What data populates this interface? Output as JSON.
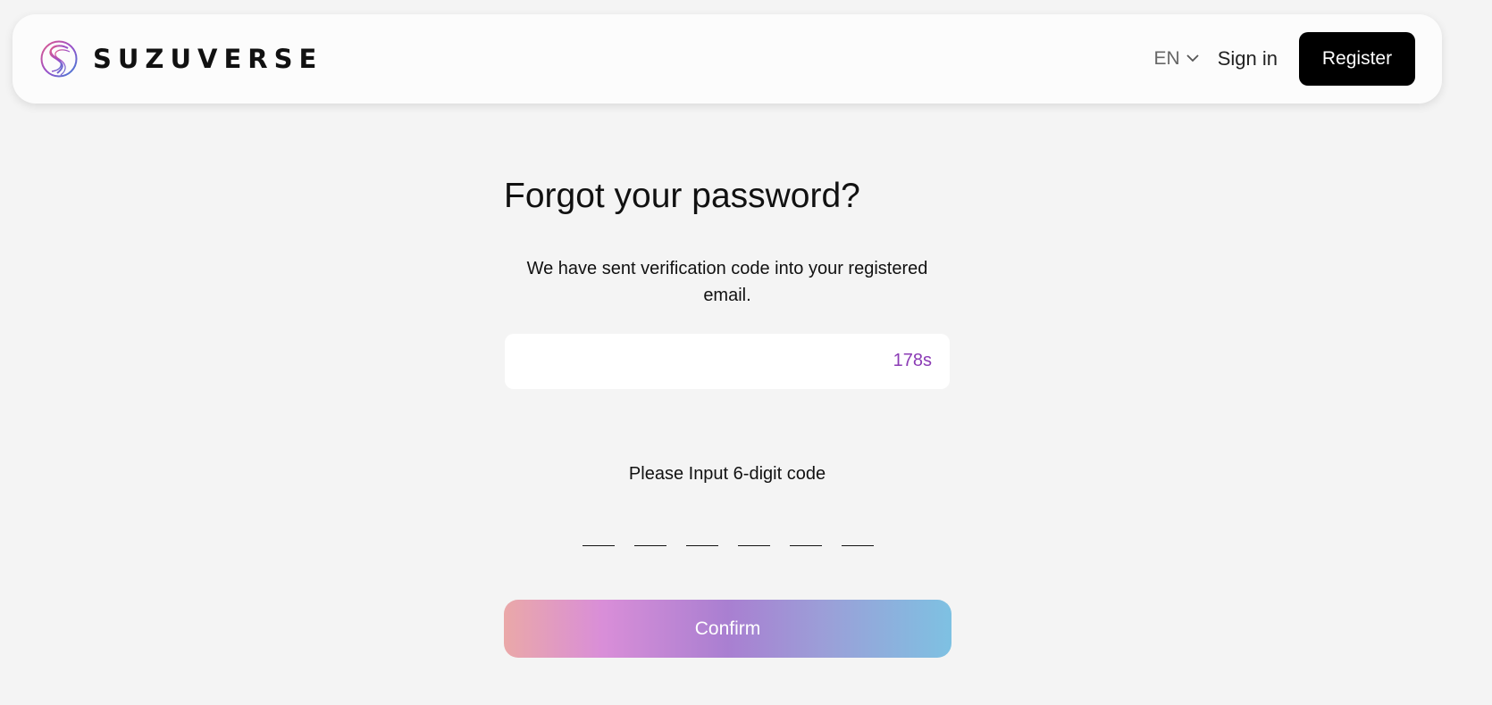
{
  "header": {
    "brand": "SUZUVERSE",
    "language": "EN",
    "sign_in_label": "Sign in",
    "register_label": "Register"
  },
  "main": {
    "title": "Forgot your password?",
    "description": "We have sent verification code into your registered email.",
    "code_input": {
      "value": "",
      "placeholder": ""
    },
    "countdown": "178s",
    "prompt": "Please Input 6-digit code",
    "digits": [
      "",
      "",
      "",
      "",
      "",
      ""
    ],
    "confirm_label": "Confirm"
  },
  "colors": {
    "background": "#f4f4f4",
    "header_bg": "#fcfcfc",
    "register_bg": "#000000",
    "timer": "#8b3bb5",
    "confirm_gradient": [
      "#eaa8a8",
      "#d98ed8",
      "#a97fd1",
      "#9b9fd8",
      "#7ec1e2"
    ]
  },
  "icons": {
    "logo": "suzuverse-logo-icon",
    "language_dropdown": "chevron-down-icon"
  }
}
